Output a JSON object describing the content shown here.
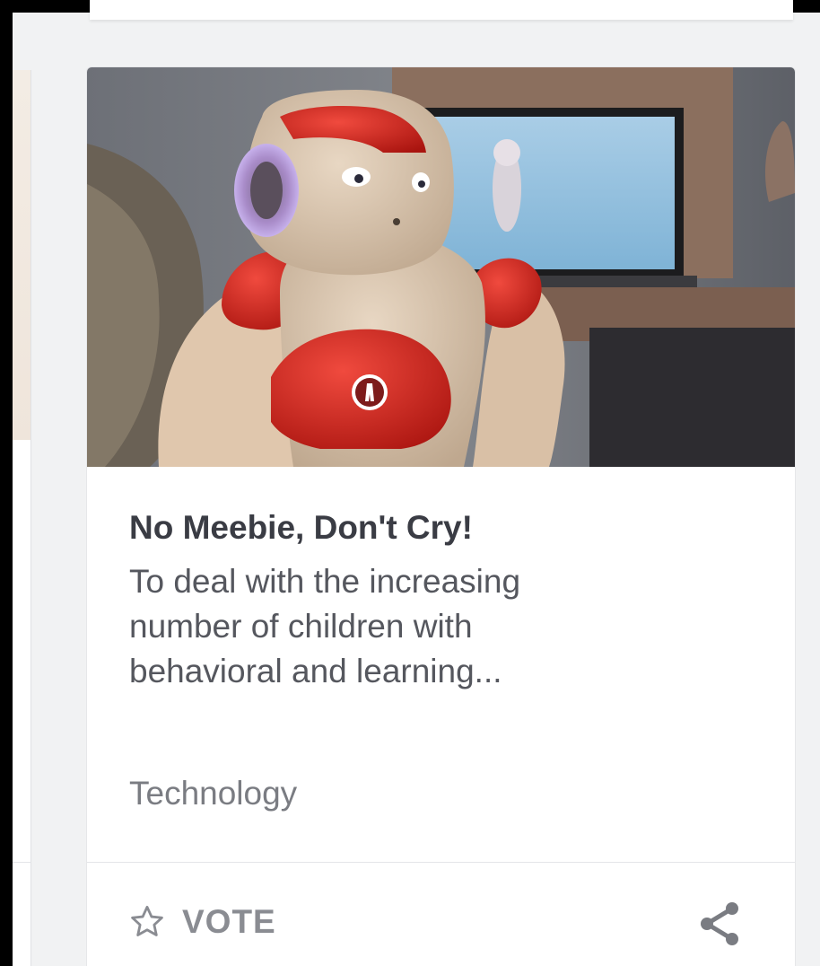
{
  "card": {
    "title": "No Meebie, Don't Cry!",
    "description_lines": [
      "To deal with the increasing",
      "number of children with",
      "behavioral and learning..."
    ],
    "category": "Technology",
    "vote_label": "VOTE"
  },
  "icons": {
    "vote": "star-outline-icon",
    "share": "share-icon"
  },
  "colors": {
    "background": "#f1f2f3",
    "card": "#ffffff",
    "title": "#3a3c44",
    "description": "#55575e",
    "muted": "#8a8c92",
    "robot_accent": "#d4231f"
  }
}
